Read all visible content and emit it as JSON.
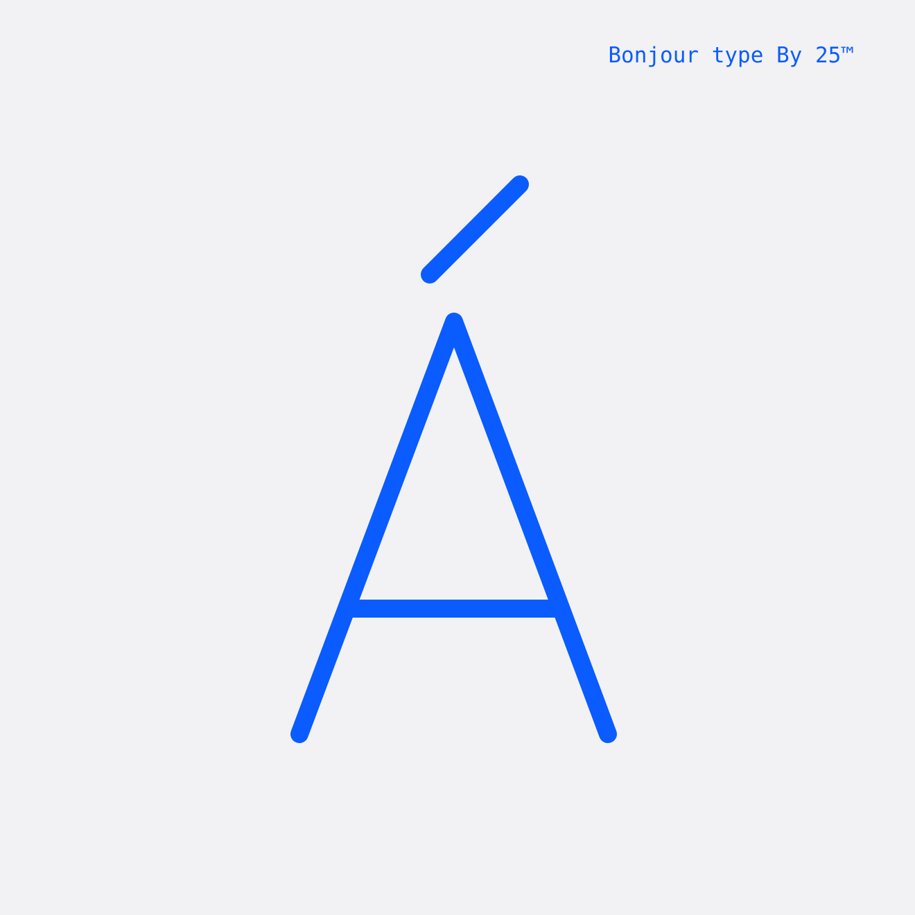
{
  "credit": {
    "text": "Bonjour type By 25™"
  },
  "glyph": {
    "character": "Á",
    "icon": "a-acute-glyph-icon"
  },
  "colors": {
    "background": "#f2f2f4",
    "accent": "#0a5cff"
  }
}
